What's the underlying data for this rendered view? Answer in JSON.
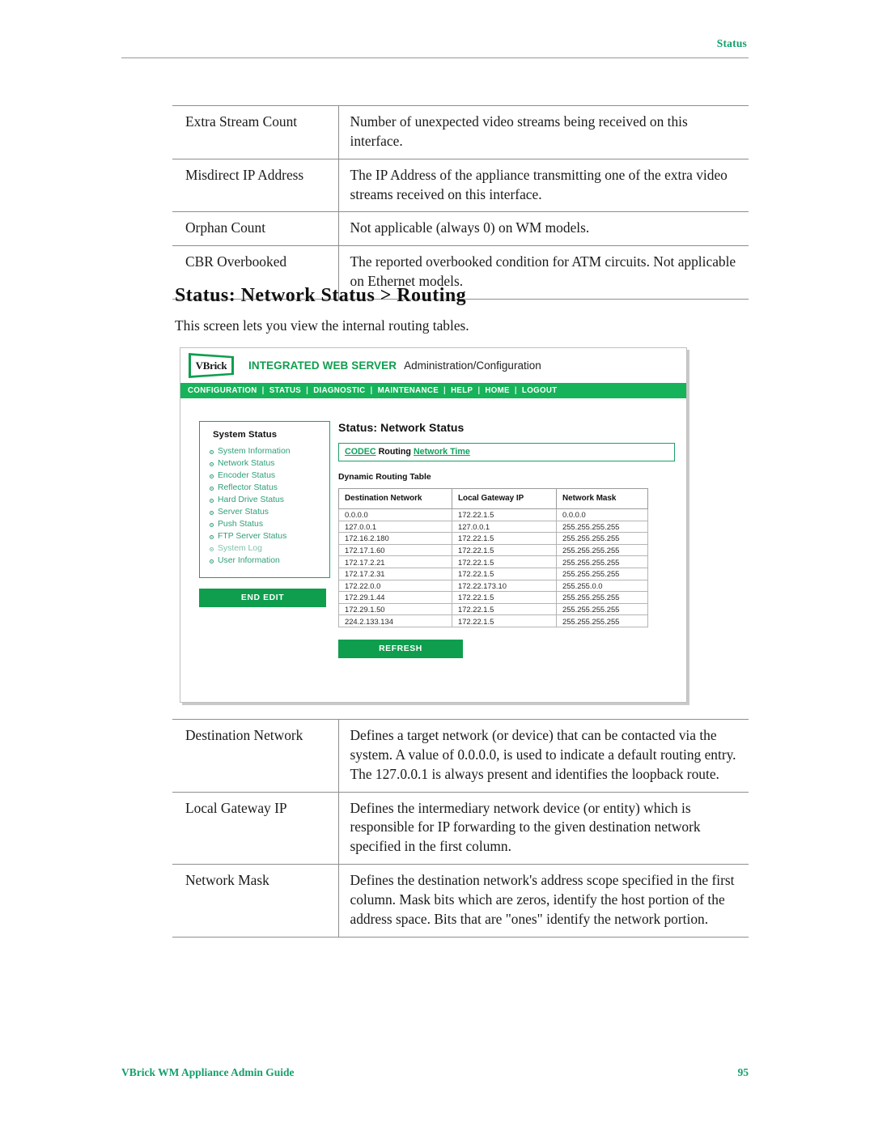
{
  "page_header": {
    "label": "Status"
  },
  "top_table": {
    "rows": [
      {
        "term": "Extra Stream Count",
        "desc": "Number of unexpected video streams being received on this interface."
      },
      {
        "term": "Misdirect IP Address",
        "desc": "The IP Address of the appliance transmitting one of the extra video streams received on this interface."
      },
      {
        "term": "Orphan Count",
        "desc": "Not applicable (always 0) on WM models."
      },
      {
        "term": "CBR Overbooked",
        "desc": "The reported overbooked condition for ATM circuits. Not applicable on Ethernet models."
      }
    ]
  },
  "section": {
    "heading": "Status: Network Status > Routing",
    "intro": "This screen lets you view the internal routing tables."
  },
  "app": {
    "brand": {
      "logo_text": "VBrick",
      "product": "INTEGRATED WEB SERVER",
      "subtitle": "Administration/Configuration"
    },
    "nav": {
      "items": [
        "CONFIGURATION",
        "STATUS",
        "DIAGNOSTIC",
        "MAINTENANCE",
        "HELP",
        "HOME",
        "LOGOUT"
      ],
      "separator": "|"
    },
    "sidebar": {
      "title": "System Status",
      "items": [
        {
          "label": "System Information",
          "dim": false
        },
        {
          "label": "Network Status",
          "dim": false
        },
        {
          "label": "Encoder Status",
          "dim": false
        },
        {
          "label": "Reflector Status",
          "dim": false
        },
        {
          "label": "Hard Drive Status",
          "dim": false
        },
        {
          "label": "Server Status",
          "dim": false
        },
        {
          "label": "Push Status",
          "dim": false
        },
        {
          "label": "FTP Server Status",
          "dim": false
        },
        {
          "label": "System Log",
          "dim": true
        },
        {
          "label": "User Information",
          "dim": false
        }
      ],
      "end_edit_label": "END EDIT"
    },
    "content": {
      "title": "Status: Network Status",
      "tabs": {
        "codec": "CODEC",
        "routing": "Routing",
        "network_time": "Network Time"
      },
      "dynamic_routing_label": "Dynamic Routing Table",
      "refresh_label": "REFRESH",
      "route_table": {
        "headers": [
          "Destination Network",
          "Local Gateway IP",
          "Network Mask"
        ],
        "rows": [
          [
            "0.0.0.0",
            "172.22.1.5",
            "0.0.0.0"
          ],
          [
            "127.0.0.1",
            "127.0.0.1",
            "255.255.255.255"
          ],
          [
            "172.16.2.180",
            "172.22.1.5",
            "255.255.255.255"
          ],
          [
            "172.17.1.60",
            "172.22.1.5",
            "255.255.255.255"
          ],
          [
            "172.17.2.21",
            "172.22.1.5",
            "255.255.255.255"
          ],
          [
            "172.17.2.31",
            "172.22.1.5",
            "255.255.255.255"
          ],
          [
            "172.22.0.0",
            "172.22.173.10",
            "255.255.0.0"
          ],
          [
            "172.29.1.44",
            "172.22.1.5",
            "255.255.255.255"
          ],
          [
            "172.29.1.50",
            "172.22.1.5",
            "255.255.255.255"
          ],
          [
            "224.2.133.134",
            "172.22.1.5",
            "255.255.255.255"
          ]
        ]
      }
    }
  },
  "bottom_table": {
    "rows": [
      {
        "term": "Destination Network",
        "desc": "Defines a target network (or device) that can be contacted via the system. A value of 0.0.0.0, is used to indicate a default routing entry. The 127.0.0.1 is always present and identifies the loopback route."
      },
      {
        "term": "Local Gateway IP",
        "desc": "Defines the intermediary network device (or entity) which is responsible for IP forwarding to the given destination network specified in the first column."
      },
      {
        "term": "Network Mask",
        "desc": "Defines the destination network's address scope specified in the first column. Mask bits which are zeros, identify the host portion of the address space. Bits that are \"ones\" identify the network portion."
      }
    ]
  },
  "page_footer": {
    "doc_title": "VBrick WM Appliance Admin Guide",
    "page_number": "95"
  },
  "colors": {
    "brand_green": "#0f9e4e",
    "nav_green": "#16b35a",
    "link_green": "#12a05e",
    "header_green": "#14a06b"
  }
}
